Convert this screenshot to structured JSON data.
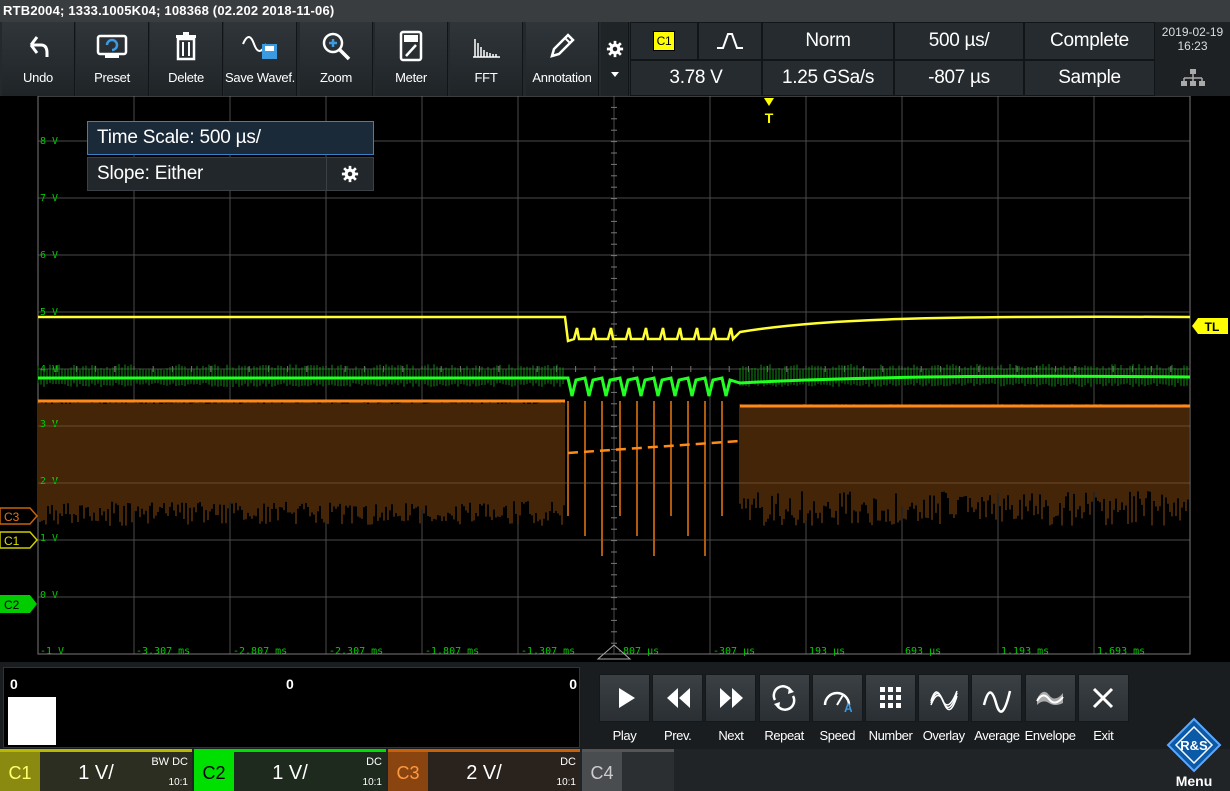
{
  "title": "RTB2004; 1333.1005K04; 108368 (02.202 2018-11-06)",
  "toolbar": {
    "items": [
      {
        "label": "Undo",
        "icon": "undo-icon"
      },
      {
        "label": "Preset",
        "icon": "preset-icon"
      },
      {
        "label": "Delete",
        "icon": "trash-icon"
      },
      {
        "label": "Save Wavef.",
        "icon": "save-waveform-icon"
      },
      {
        "label": "Zoom",
        "icon": "zoom-icon"
      },
      {
        "label": "Meter",
        "icon": "meter-icon"
      },
      {
        "label": "FFT",
        "icon": "fft-icon"
      },
      {
        "label": "Annotation",
        "icon": "pencil-icon"
      }
    ]
  },
  "trigger": {
    "source": "C1",
    "level": "3.78 V",
    "mode": "Norm",
    "sample_rate": "1.25 GSa/s",
    "timebase": "500 µs/",
    "position": "-807 µs",
    "acq_status": "Complete",
    "acq_mode": "Sample"
  },
  "datetime": {
    "date": "2019-02-19",
    "time": "16:23"
  },
  "popup": {
    "time_scale": "Time Scale: 500 µs/",
    "slope": "Slope: Either"
  },
  "grid": {
    "y_labels": [
      "8 V",
      "7 V",
      "6 V",
      "5 V",
      "4 V",
      "3 V",
      "2 V",
      "1 V",
      "0 V",
      "-1 V"
    ],
    "x_labels": [
      "-3.307 ms",
      "-2.807 ms",
      "-2.307 ms",
      "-1.807 ms",
      "-1.307 ms",
      "-807 µs",
      "-307 µs",
      "193 µs",
      "693 µs",
      "1.193 ms",
      "1.693 ms"
    ],
    "trigger_marker": "T",
    "trigger_level_marker": "TL",
    "channel_markers": [
      "C3",
      "C1",
      "C2"
    ]
  },
  "histogram": {
    "left": "0",
    "mid": "0",
    "right": "0"
  },
  "controls": [
    {
      "label": "Play",
      "icon": "play-icon"
    },
    {
      "label": "Prev.",
      "icon": "previous-icon"
    },
    {
      "label": "Next",
      "icon": "next-icon"
    },
    {
      "label": "Repeat",
      "icon": "repeat-icon"
    },
    {
      "label": "Speed",
      "icon": "speed-icon"
    },
    {
      "label": "Number",
      "icon": "number-grid-icon"
    },
    {
      "label": "Overlay",
      "icon": "overlay-icon"
    },
    {
      "label": "Average",
      "icon": "average-icon"
    },
    {
      "label": "Envelope",
      "icon": "envelope-icon"
    },
    {
      "label": "Exit",
      "icon": "close-icon"
    }
  ],
  "channels": [
    {
      "name": "C1",
      "scale": "1 V/",
      "coupling": "DC",
      "bw": "BW",
      "probe": "10:1",
      "color": "#d4d400"
    },
    {
      "name": "C2",
      "scale": "1 V/",
      "coupling": "DC",
      "probe": "10:1",
      "color": "#00e000"
    },
    {
      "name": "C3",
      "scale": "2 V/",
      "coupling": "DC",
      "probe": "10:1",
      "color": "#c8620a"
    },
    {
      "name": "C4",
      "color": "#8a8a8a"
    }
  ],
  "menu_label": "Menu",
  "colors": {
    "ch1": "#ffff33",
    "ch2": "#22ff22",
    "ch3": "#ff8a1a",
    "grid": "#555555",
    "accent": "#3b7fc4"
  }
}
